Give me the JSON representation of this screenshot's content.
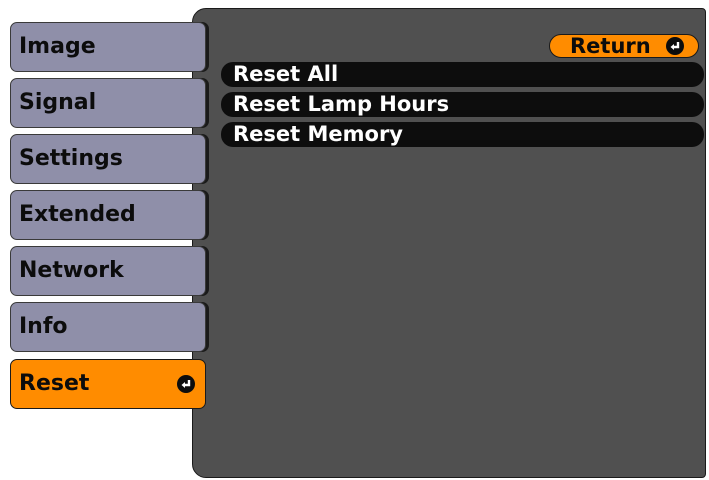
{
  "menu": {
    "tabs": [
      {
        "label": "Image"
      },
      {
        "label": "Signal"
      },
      {
        "label": "Settings"
      },
      {
        "label": "Extended"
      },
      {
        "label": "Network"
      },
      {
        "label": "Info"
      },
      {
        "label": "Reset",
        "selected": true
      }
    ]
  },
  "panel": {
    "return_label": "Return",
    "options": [
      {
        "label": "Reset All"
      },
      {
        "label": "Reset Lamp Hours"
      },
      {
        "label": "Reset Memory"
      }
    ]
  },
  "colors": {
    "tab": "#8f8fa9",
    "accent": "#ff8c00",
    "panel": "#505050",
    "option_bar": "#0d0d0d"
  },
  "icons": {
    "enter": "enter-icon"
  }
}
